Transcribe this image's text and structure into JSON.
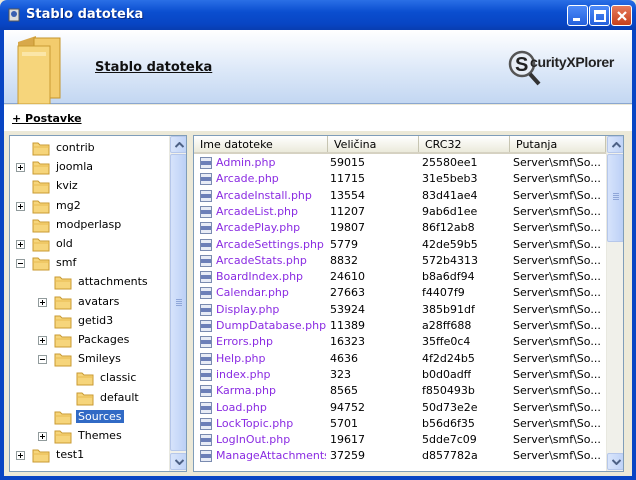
{
  "window": {
    "title": "Stablo datoteka",
    "colors": {
      "titlebar": "#0845c4",
      "selection": "#316ac5",
      "link": "#8a2be2"
    }
  },
  "header": {
    "title": "Stablo datoteka",
    "logo_text": "curityXPlorer"
  },
  "toolbar": {
    "settings_label": "+ Postavke"
  },
  "tree": {
    "items": [
      {
        "label": "contrib",
        "level": 0,
        "expander": "none"
      },
      {
        "label": "joomla",
        "level": 0,
        "expander": "plus"
      },
      {
        "label": "kviz",
        "level": 0,
        "expander": "none"
      },
      {
        "label": "mg2",
        "level": 0,
        "expander": "plus"
      },
      {
        "label": "modperlasp",
        "level": 0,
        "expander": "none"
      },
      {
        "label": "old",
        "level": 0,
        "expander": "plus"
      },
      {
        "label": "smf",
        "level": 0,
        "expander": "minus"
      },
      {
        "label": "attachments",
        "level": 1,
        "expander": "none"
      },
      {
        "label": "avatars",
        "level": 1,
        "expander": "plus"
      },
      {
        "label": "getid3",
        "level": 1,
        "expander": "none"
      },
      {
        "label": "Packages",
        "level": 1,
        "expander": "plus"
      },
      {
        "label": "Smileys",
        "level": 1,
        "expander": "minus"
      },
      {
        "label": "classic",
        "level": 2,
        "expander": "none"
      },
      {
        "label": "default",
        "level": 2,
        "expander": "none"
      },
      {
        "label": "Sources",
        "level": 1,
        "expander": "none",
        "selected": true
      },
      {
        "label": "Themes",
        "level": 1,
        "expander": "plus"
      },
      {
        "label": "test1",
        "level": 0,
        "expander": "plus"
      }
    ]
  },
  "list": {
    "columns": [
      "Ime datoteke",
      "Veličina",
      "CRC32",
      "Putanja"
    ],
    "rows": [
      {
        "name": "Admin.php",
        "size": "59015",
        "crc": "25580ee1",
        "path": "Server\\smf\\So..."
      },
      {
        "name": "Arcade.php",
        "size": "11715",
        "crc": "31e5beb3",
        "path": "Server\\smf\\So..."
      },
      {
        "name": "ArcadeInstall.php",
        "size": "13554",
        "crc": "83d41ae4",
        "path": "Server\\smf\\So..."
      },
      {
        "name": "ArcadeList.php",
        "size": "11207",
        "crc": "9ab6d1ee",
        "path": "Server\\smf\\So..."
      },
      {
        "name": "ArcadePlay.php",
        "size": "19807",
        "crc": "86f12ab8",
        "path": "Server\\smf\\So..."
      },
      {
        "name": "ArcadeSettings.php",
        "size": "5779",
        "crc": "42de59b5",
        "path": "Server\\smf\\So..."
      },
      {
        "name": "ArcadeStats.php",
        "size": "8832",
        "crc": "572b4313",
        "path": "Server\\smf\\So..."
      },
      {
        "name": "BoardIndex.php",
        "size": "24610",
        "crc": "b8a6df94",
        "path": "Server\\smf\\So..."
      },
      {
        "name": "Calendar.php",
        "size": "27663",
        "crc": "f4407f9",
        "path": "Server\\smf\\So..."
      },
      {
        "name": "Display.php",
        "size": "53924",
        "crc": "385b91df",
        "path": "Server\\smf\\So..."
      },
      {
        "name": "DumpDatabase.php",
        "size": "11389",
        "crc": "a28ff688",
        "path": "Server\\smf\\So..."
      },
      {
        "name": "Errors.php",
        "size": "16323",
        "crc": "35ffe0c4",
        "path": "Server\\smf\\So..."
      },
      {
        "name": "Help.php",
        "size": "4636",
        "crc": "4f2d24b5",
        "path": "Server\\smf\\So..."
      },
      {
        "name": "index.php",
        "size": "323",
        "crc": "b0d0adff",
        "path": "Server\\smf\\So..."
      },
      {
        "name": "Karma.php",
        "size": "8565",
        "crc": "f850493b",
        "path": "Server\\smf\\So..."
      },
      {
        "name": "Load.php",
        "size": "94752",
        "crc": "50d73e2e",
        "path": "Server\\smf\\So..."
      },
      {
        "name": "LockTopic.php",
        "size": "5701",
        "crc": "b56d6f35",
        "path": "Server\\smf\\So..."
      },
      {
        "name": "LogInOut.php",
        "size": "19617",
        "crc": "5dde7c09",
        "path": "Server\\smf\\So..."
      },
      {
        "name": "ManageAttachments....",
        "size": "37259",
        "crc": "d857782a",
        "path": "Server\\smf\\So..."
      }
    ]
  }
}
